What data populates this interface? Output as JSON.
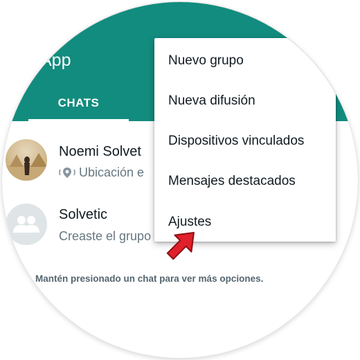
{
  "app": {
    "title": "App"
  },
  "tabs": [
    {
      "label": "CHATS",
      "active": true
    }
  ],
  "chats": [
    {
      "name": "Noemi Solvet",
      "preview": "Ubicación e",
      "preview_icon": "location-pin-icon",
      "avatar": "photo"
    },
    {
      "name": "Solvetic",
      "preview": "Creaste el grupo",
      "avatar": "group-icon"
    }
  ],
  "hint": "Mantén presionado un chat para ver más opciones.",
  "menu": {
    "items": [
      {
        "label": "Nuevo grupo"
      },
      {
        "label": "Nueva difusión"
      },
      {
        "label": "Dispositivos vinculados"
      },
      {
        "label": "Mensajes destacados"
      },
      {
        "label": "Ajustes",
        "highlighted_by_arrow": true
      }
    ]
  },
  "colors": {
    "header": "#128c7e",
    "arrow": "#e0202a",
    "text_primary": "#111b21",
    "text_secondary": "#667781"
  }
}
